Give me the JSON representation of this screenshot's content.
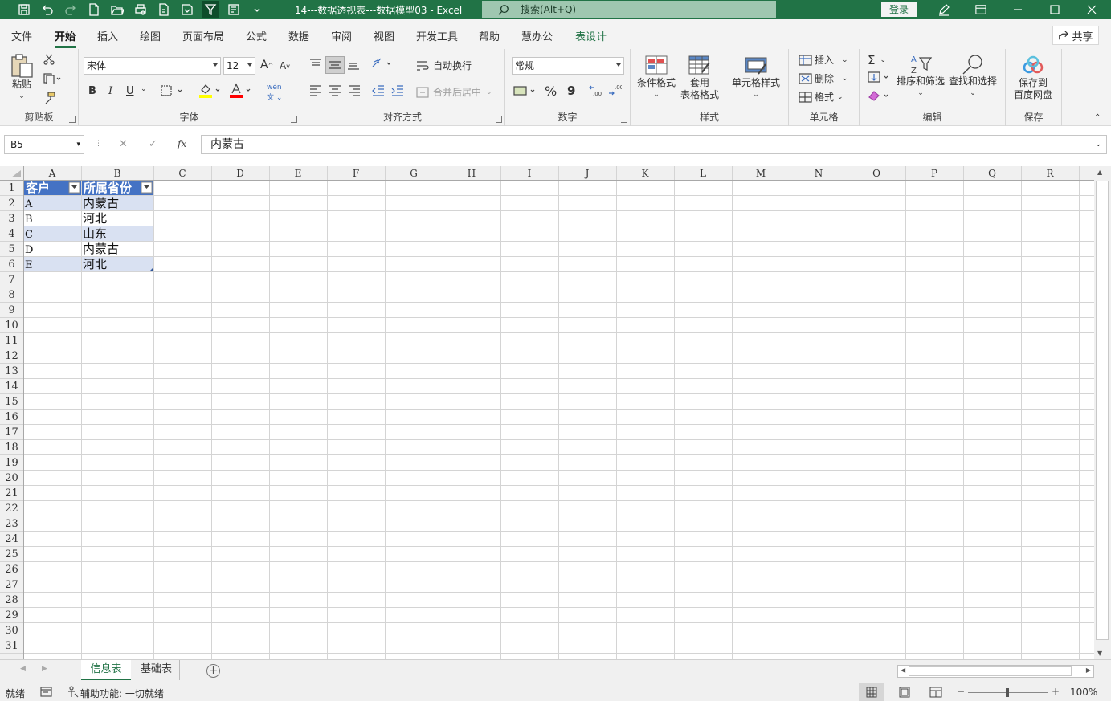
{
  "window": {
    "title": "14---数据透视表---数据模型03  -  Excel",
    "search_placeholder": "搜索(Alt+Q)",
    "login_label": "登录",
    "controls": [
      "minimize-icon",
      "maximize-icon",
      "close-icon"
    ],
    "quick_access": [
      "save-icon",
      "undo-icon",
      "redo-icon",
      "new-file-icon",
      "open-file-icon",
      "print-preview-icon",
      "print-icon",
      "export-pdf-icon",
      "filter-icon",
      "form-icon",
      "customize-qat-icon"
    ],
    "accent_color": "#217346"
  },
  "ribbon_tabs": [
    {
      "label": "文件",
      "active": false
    },
    {
      "label": "开始",
      "active": true
    },
    {
      "label": "插入",
      "active": false
    },
    {
      "label": "绘图",
      "active": false
    },
    {
      "label": "页面布局",
      "active": false
    },
    {
      "label": "公式",
      "active": false
    },
    {
      "label": "数据",
      "active": false
    },
    {
      "label": "审阅",
      "active": false
    },
    {
      "label": "视图",
      "active": false
    },
    {
      "label": "开发工具",
      "active": false
    },
    {
      "label": "帮助",
      "active": false
    },
    {
      "label": "慧办公",
      "active": false
    },
    {
      "label": "表设计",
      "active": false,
      "contextual": true
    }
  ],
  "share_label": "共享",
  "ribbon": {
    "clipboard": {
      "label": "剪贴板",
      "paste": "粘贴"
    },
    "font": {
      "label": "字体",
      "font_name": "宋体",
      "font_size": "12",
      "bold": "B",
      "italic": "I",
      "underline": "U",
      "font_color": "#ff0000",
      "fill_color": "#ffff00"
    },
    "alignment": {
      "label": "对齐方式",
      "wrap_text": "自动换行",
      "merge_center": "合并后居中"
    },
    "number": {
      "label": "数字",
      "format": "常规",
      "percent": "%",
      "comma": "9"
    },
    "styles": {
      "label": "样式",
      "conditional": "条件格式",
      "table_format_1": "套用",
      "table_format_2": "表格格式",
      "cell_styles": "单元格样式"
    },
    "cells": {
      "label": "单元格",
      "insert": "插入",
      "delete": "删除",
      "format": "格式"
    },
    "editing": {
      "label": "编辑",
      "sort_filter": "排序和筛选",
      "find_select": "查找和选择"
    },
    "save": {
      "label": "保存",
      "save_to_1": "保存到",
      "save_to_2": "百度网盘"
    }
  },
  "formula_bar": {
    "name_box": "B5",
    "fx_label": "fx",
    "content": "内蒙古"
  },
  "sheet": {
    "columns": [
      "A",
      "B",
      "C",
      "D",
      "E",
      "F",
      "G",
      "H",
      "I",
      "J",
      "K",
      "L",
      "M",
      "N",
      "O",
      "P",
      "Q",
      "R"
    ],
    "visible_rows": 31,
    "table_header": [
      "客户",
      "所属省份"
    ],
    "table_rows": [
      [
        "A",
        "内蒙古"
      ],
      [
        "B",
        "河北"
      ],
      [
        "C",
        "山东"
      ],
      [
        "D",
        "内蒙古"
      ],
      [
        "E",
        "河北"
      ]
    ],
    "header_color": "#4472c4",
    "band_color": "#d9e1f2",
    "selected_cell": "B5"
  },
  "sheet_tabs": [
    {
      "label": "信息表",
      "active": true
    },
    {
      "label": "基础表",
      "active": false
    }
  ],
  "status": {
    "ready": "就绪",
    "accessibility": "辅助功能: 一切就绪",
    "zoom": "100%",
    "zoom_minus": "−",
    "zoom_plus": "+"
  }
}
